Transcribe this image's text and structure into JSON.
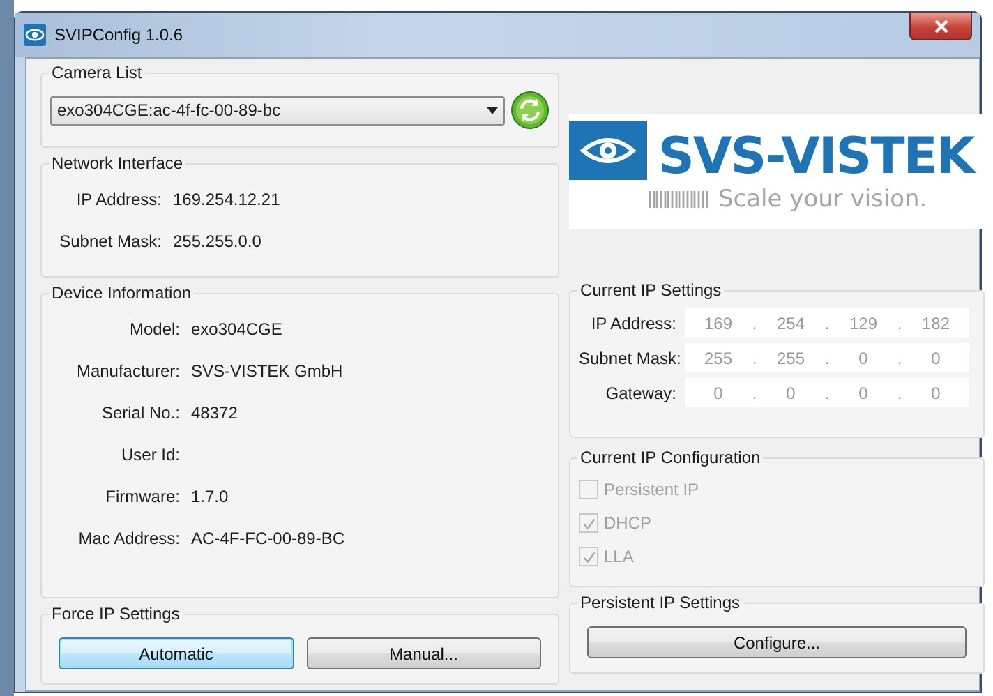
{
  "window": {
    "title": "SVIPConfig 1.0.6"
  },
  "camera_list": {
    "title": "Camera List",
    "value": "exo304CGE:ac-4f-fc-00-89-bc"
  },
  "network_interface": {
    "title": "Network Interface",
    "rows": [
      {
        "label": "IP Address:",
        "value": "169.254.12.21"
      },
      {
        "label": "Subnet Mask:",
        "value": "255.255.0.0"
      }
    ]
  },
  "device_information": {
    "title": "Device Information",
    "rows": [
      {
        "label": "Model:",
        "value": "exo304CGE"
      },
      {
        "label": "Manufacturer:",
        "value": "SVS-VISTEK GmbH"
      },
      {
        "label": "Serial No.:",
        "value": "48372"
      },
      {
        "label": "User Id:"
      },
      {
        "label": "Firmware:",
        "value": "1.7.0"
      },
      {
        "label": "Mac Address:",
        "value": "AC-4F-FC-00-89-BC"
      }
    ]
  },
  "force_ip_settings": {
    "title": "Force IP Settings",
    "buttons": [
      {
        "label": "Automatic",
        "focused": true
      },
      {
        "label": "Manual...",
        "focused": false
      }
    ]
  },
  "logo": {
    "name": "SVS-VISTEK",
    "tagline": "Scale your vision."
  },
  "current_ip_settings": {
    "title": "Current IP Settings",
    "separator": ".",
    "rows": [
      {
        "label": "IP Address:",
        "octets": [
          "169",
          "254",
          "129",
          "182"
        ]
      },
      {
        "label": "Subnet Mask:",
        "octets": [
          "255",
          "255",
          "0",
          "0"
        ]
      },
      {
        "label": "Gateway:",
        "octets": [
          "0",
          "0",
          "0",
          "0"
        ]
      }
    ]
  },
  "current_ip_configuration": {
    "title": "Current IP Configuration",
    "options": [
      {
        "label": "Persistent IP",
        "checked": false,
        "disabled": true
      },
      {
        "label": "DHCP",
        "checked": true,
        "disabled": true
      },
      {
        "label": "LLA",
        "checked": true,
        "disabled": true
      }
    ]
  },
  "persistent_ip_settings": {
    "title": "Persistent IP Settings",
    "buttons": [
      {
        "label": "Configure...",
        "focused": false
      }
    ]
  }
}
